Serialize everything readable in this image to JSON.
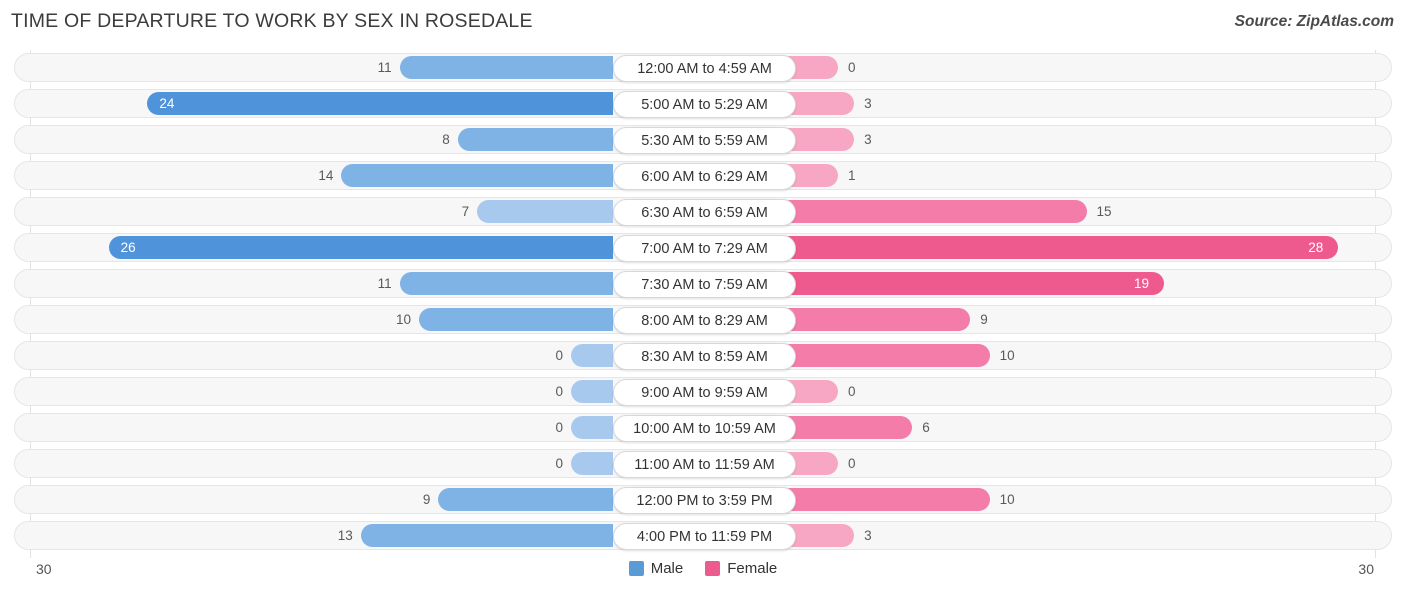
{
  "header": {
    "title": "TIME OF DEPARTURE TO WORK BY SEX IN ROSEDALE",
    "source": "Source: ZipAtlas.com"
  },
  "legend": {
    "items": [
      {
        "label": "Male",
        "color": "#5B9BD5"
      },
      {
        "label": "Female",
        "color": "#EC5B8E"
      }
    ]
  },
  "axis": {
    "left_end": "30",
    "right_end": "30",
    "max": 30
  },
  "colors": {
    "male_high": "#4F94DB",
    "male_mid": "#7FB2E5",
    "male_low": "#A8C9EE",
    "female_high": "#EF5A8E",
    "female_mid": "#F47CA8",
    "female_low": "#F7A7C4",
    "row_bg": "#f7f7f7",
    "row_border": "#e6e6e6",
    "grid": "#e2e2e2",
    "pill_bg": "#ffffff",
    "text": "#5a5a5a"
  },
  "chart_data": {
    "type": "bar",
    "title": "TIME OF DEPARTURE TO WORK BY SEX IN ROSEDALE",
    "subtitle": "",
    "xlabel": "",
    "ylabel": "",
    "orientation": "horizontal-diverging",
    "legend_position": "bottom-center",
    "grid": true,
    "xlim": [
      30,
      30
    ],
    "categories": [
      "12:00 AM to 4:59 AM",
      "5:00 AM to 5:29 AM",
      "5:30 AM to 5:59 AM",
      "6:00 AM to 6:29 AM",
      "6:30 AM to 6:59 AM",
      "7:00 AM to 7:29 AM",
      "7:30 AM to 7:59 AM",
      "8:00 AM to 8:29 AM",
      "8:30 AM to 8:59 AM",
      "9:00 AM to 9:59 AM",
      "10:00 AM to 10:59 AM",
      "11:00 AM to 11:59 AM",
      "12:00 PM to 3:59 PM",
      "4:00 PM to 11:59 PM"
    ],
    "series": [
      {
        "name": "Male",
        "side": "left",
        "values": [
          11,
          24,
          8,
          14,
          7,
          26,
          11,
          10,
          0,
          0,
          0,
          0,
          9,
          13
        ]
      },
      {
        "name": "Female",
        "side": "right",
        "values": [
          0,
          3,
          3,
          1,
          15,
          28,
          19,
          9,
          10,
          0,
          6,
          0,
          10,
          3
        ]
      }
    ]
  },
  "rows": [
    {
      "label": "12:00 AM to 4:59 AM",
      "male": "11",
      "female": "0"
    },
    {
      "label": "5:00 AM to 5:29 AM",
      "male": "24",
      "female": "3"
    },
    {
      "label": "5:30 AM to 5:59 AM",
      "male": "8",
      "female": "3"
    },
    {
      "label": "6:00 AM to 6:29 AM",
      "male": "14",
      "female": "1"
    },
    {
      "label": "6:30 AM to 6:59 AM",
      "male": "7",
      "female": "15"
    },
    {
      "label": "7:00 AM to 7:29 AM",
      "male": "26",
      "female": "28"
    },
    {
      "label": "7:30 AM to 7:59 AM",
      "male": "11",
      "female": "19"
    },
    {
      "label": "8:00 AM to 8:29 AM",
      "male": "10",
      "female": "9"
    },
    {
      "label": "8:30 AM to 8:59 AM",
      "male": "0",
      "female": "10"
    },
    {
      "label": "9:00 AM to 9:59 AM",
      "male": "0",
      "female": "0"
    },
    {
      "label": "10:00 AM to 10:59 AM",
      "male": "0",
      "female": "6"
    },
    {
      "label": "11:00 AM to 11:59 AM",
      "male": "0",
      "female": "0"
    },
    {
      "label": "12:00 PM to 3:59 PM",
      "male": "9",
      "female": "10"
    },
    {
      "label": "4:00 PM to 11:59 PM",
      "male": "13",
      "female": "3"
    }
  ]
}
